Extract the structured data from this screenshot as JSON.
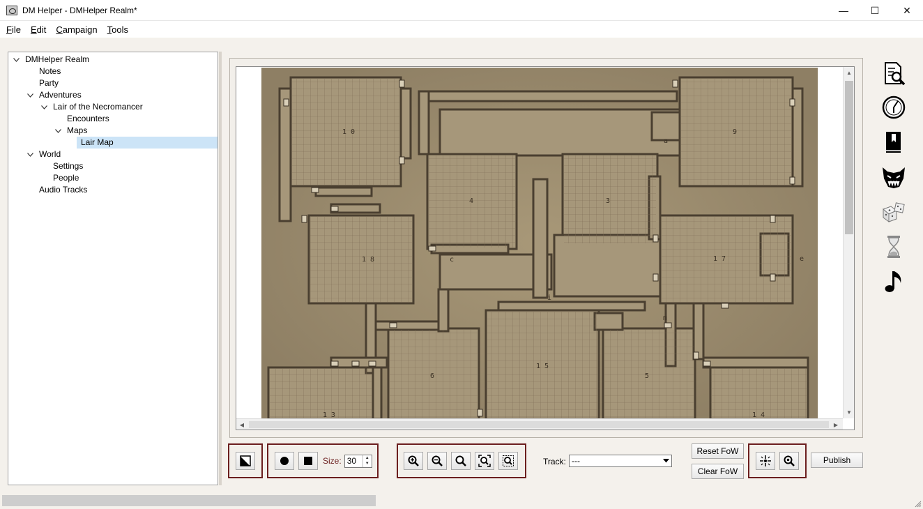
{
  "window": {
    "title": "DM Helper - DMHelper Realm*",
    "minimize_glyph": "—",
    "maximize_glyph": "☐",
    "close_glyph": "✕"
  },
  "menu": [
    {
      "label": "File",
      "mnemonic": "F",
      "rest": "ile"
    },
    {
      "label": "Edit",
      "mnemonic": "E",
      "rest": "dit"
    },
    {
      "label": "Campaign",
      "mnemonic": "C",
      "rest": "ampaign"
    },
    {
      "label": "Tools",
      "mnemonic": "T",
      "rest": "ools"
    }
  ],
  "tree": [
    {
      "label": "DMHelper Realm",
      "level": 0,
      "expanded": true
    },
    {
      "label": "Notes",
      "level": 1
    },
    {
      "label": "Party",
      "level": 1
    },
    {
      "label": "Adventures",
      "level": 1,
      "expanded": true
    },
    {
      "label": "Lair of the Necromancer",
      "level": 2,
      "expanded": true
    },
    {
      "label": "Encounters",
      "level": 3
    },
    {
      "label": "Maps",
      "level": 3,
      "expanded": true
    },
    {
      "label": "Lair Map",
      "level": 4,
      "selected": true
    },
    {
      "label": "World",
      "level": 1,
      "expanded": true
    },
    {
      "label": "Settings",
      "level": 2
    },
    {
      "label": "People",
      "level": 2
    },
    {
      "label": "Audio Tracks",
      "level": 1
    }
  ],
  "map": {
    "room_labels": [
      {
        "text": "1 0"
      },
      {
        "text": "9"
      },
      {
        "text": "a"
      },
      {
        "text": "4"
      },
      {
        "text": "3"
      },
      {
        "text": "1 8"
      },
      {
        "text": "c"
      },
      {
        "text": "1 7"
      },
      {
        "text": "e"
      },
      {
        "text": "i"
      },
      {
        "text": "m"
      },
      {
        "text": "6"
      },
      {
        "text": "1 5"
      },
      {
        "text": "5"
      },
      {
        "text": "1 3"
      },
      {
        "text": "1 4"
      }
    ],
    "parchment_color": "#9b8b70",
    "wall_color": "#4a3f30"
  },
  "toolbar": {
    "size_label": "Size:",
    "size_value": "30",
    "track_label": "Track:",
    "track_value": "---",
    "reset_fow": "Reset FoW",
    "clear_fow": "Clear FoW",
    "publish": "Publish"
  },
  "side_icons": [
    "search-document-icon",
    "compass-clock-icon",
    "bookmark-book-icon",
    "monster-face-icon",
    "dice-icon",
    "hourglass-icon",
    "music-note-icon"
  ],
  "colors": {
    "group_border": "#6b1e1e",
    "selection": "#cce4f7"
  }
}
